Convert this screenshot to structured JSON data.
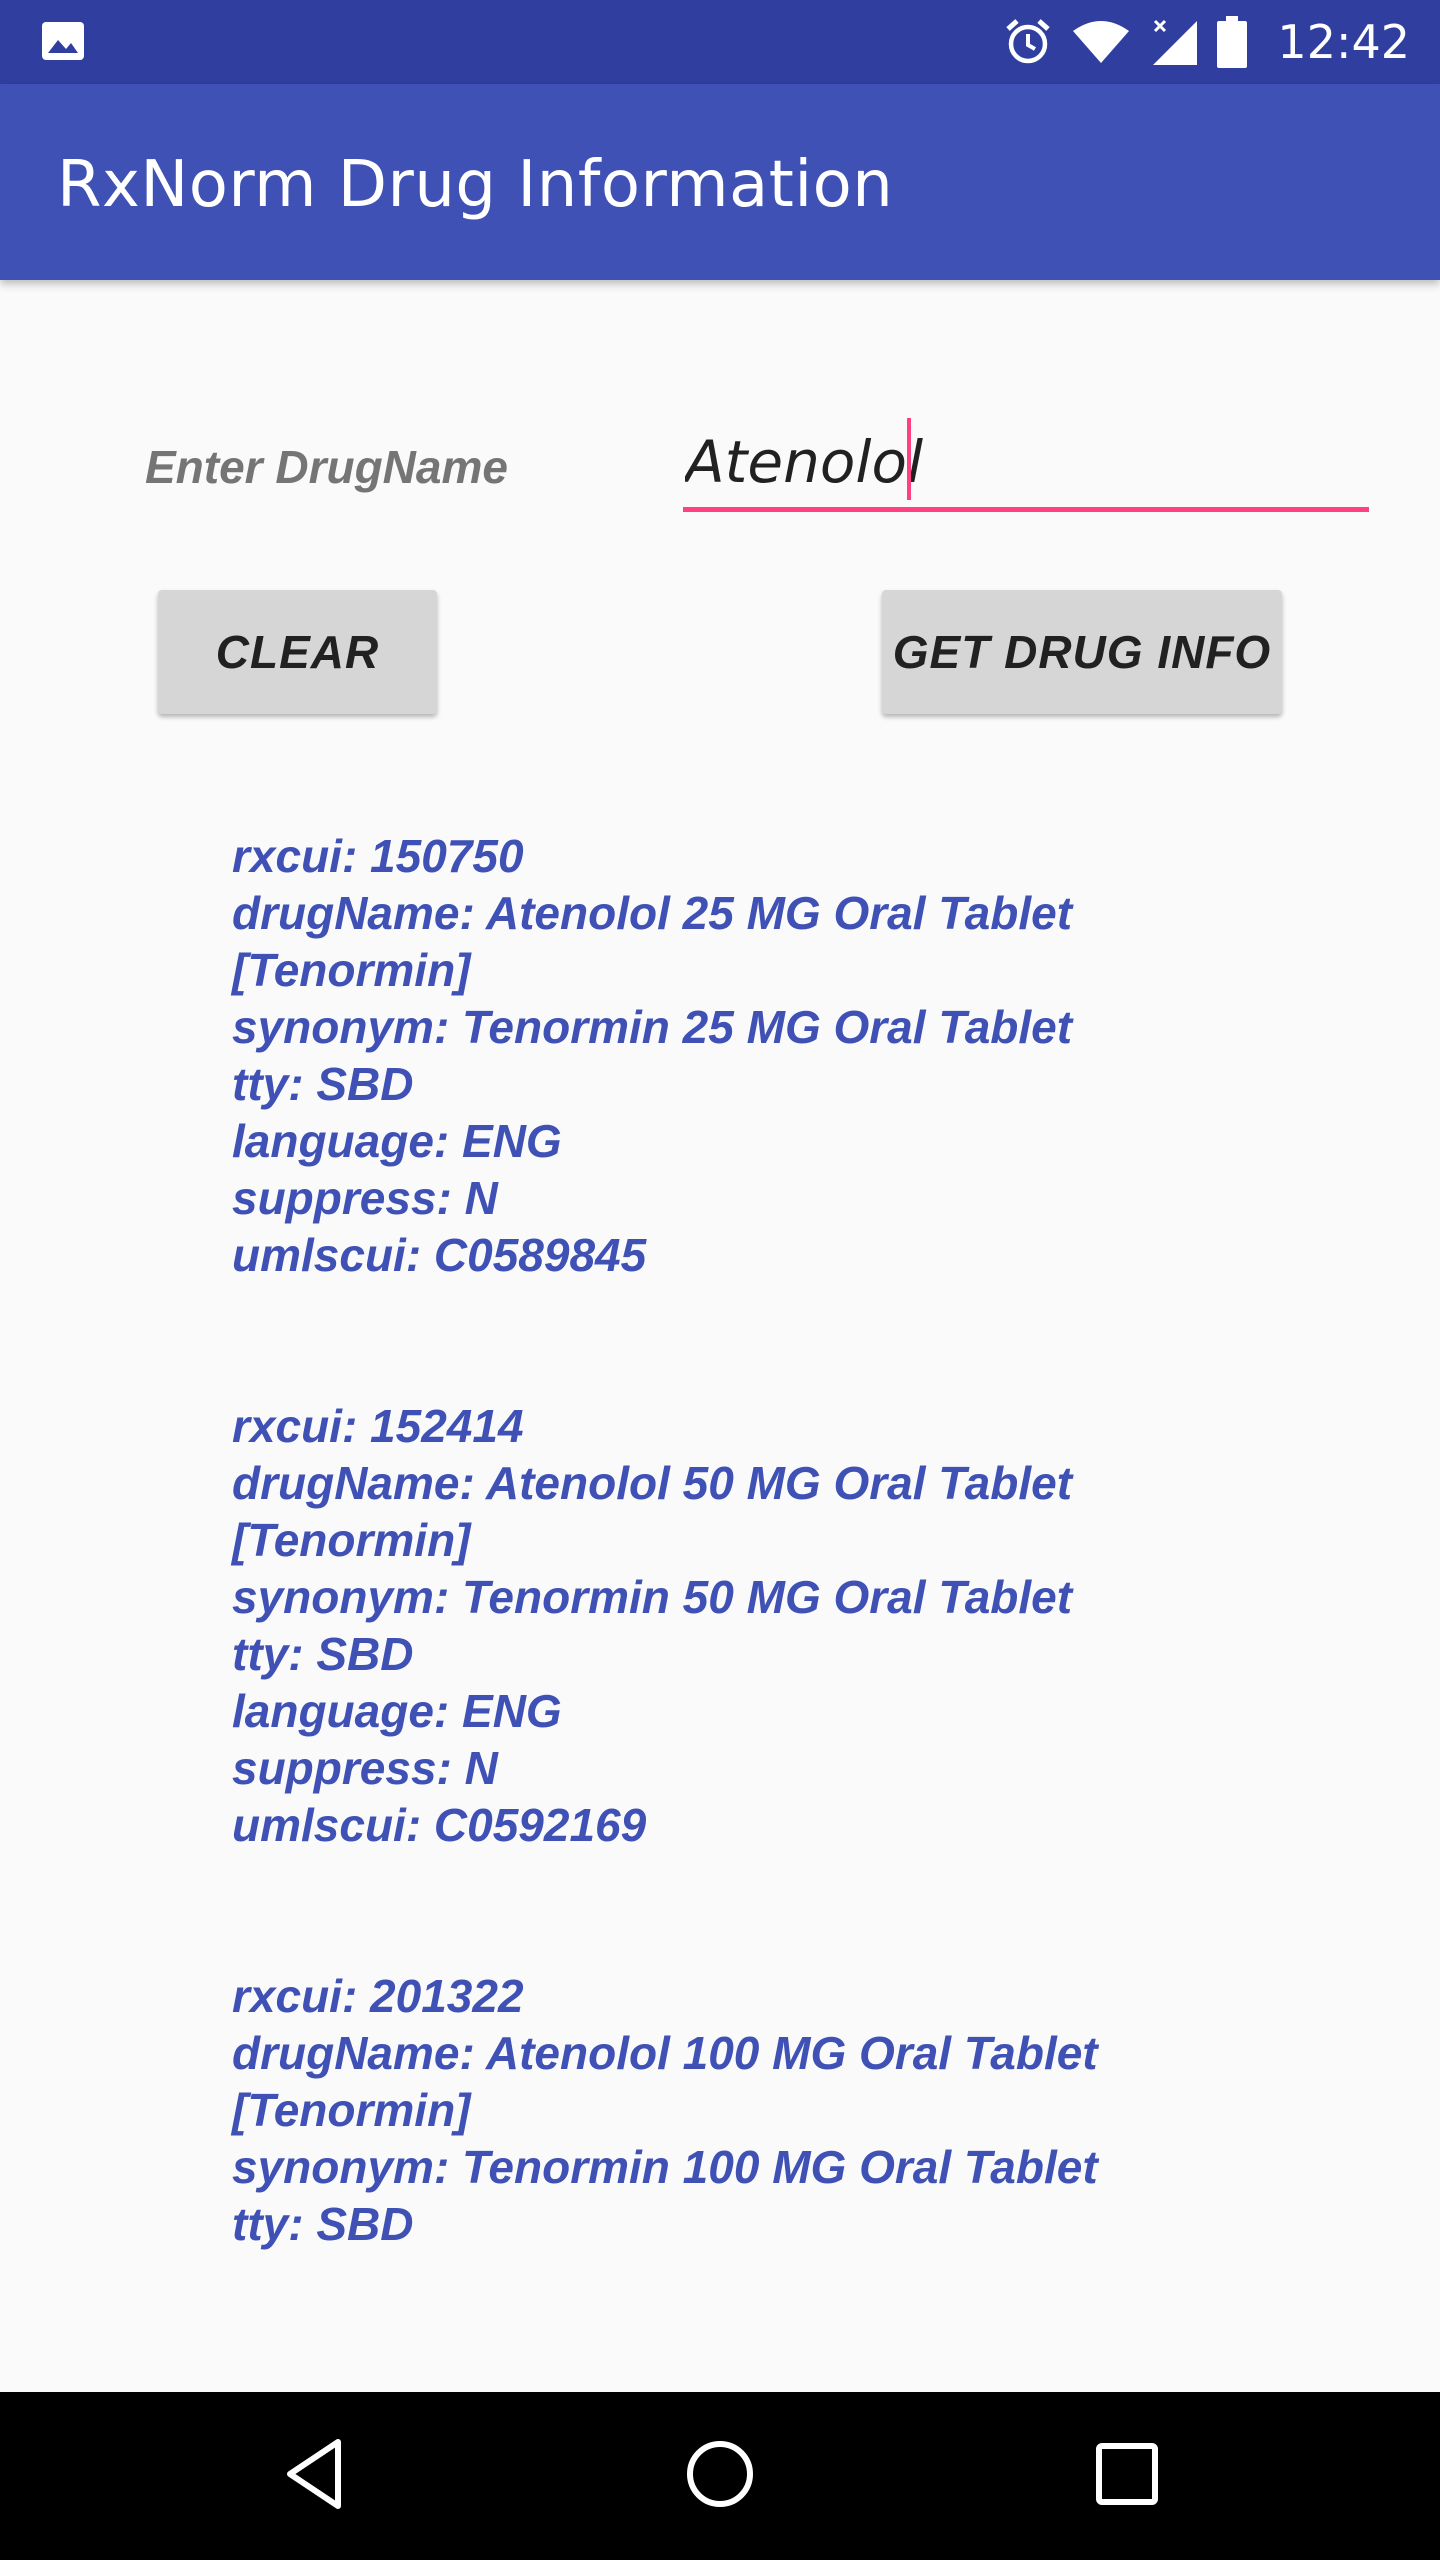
{
  "status_bar": {
    "time": "12:42",
    "icons": [
      "gallery-icon",
      "alarm-icon",
      "wifi-icon",
      "signal-icon",
      "battery-icon"
    ]
  },
  "app_bar": {
    "title": "RxNorm Drug Information"
  },
  "form": {
    "label": "Enter DrugName",
    "input_value": "Atenolol",
    "clear_label": "CLEAR",
    "get_info_label": "GET DRUG INFO"
  },
  "results": [
    {
      "rxcui": "rxcui: 150750",
      "drugName_line1": "drugName: Atenolol 25 MG Oral Tablet",
      "drugName_line2": "[Tenormin]",
      "synonym": "synonym: Tenormin 25 MG Oral Tablet",
      "tty": "tty: SBD",
      "language": "language: ENG",
      "suppress": "suppress: N",
      "umlscui": "umlscui: C0589845"
    },
    {
      "rxcui": "rxcui: 152414",
      "drugName_line1": "drugName: Atenolol 50 MG Oral Tablet",
      "drugName_line2": "[Tenormin]",
      "synonym": "synonym: Tenormin 50 MG Oral Tablet",
      "tty": "tty: SBD",
      "language": "language: ENG",
      "suppress": "suppress: N",
      "umlscui": "umlscui: C0592169"
    },
    {
      "rxcui": "rxcui: 201322",
      "drugName_line1": "drugName: Atenolol 100 MG Oral Tablet",
      "drugName_line2": "[Tenormin]",
      "synonym": "synonym: Tenormin 100 MG Oral Tablet",
      "tty": "tty: SBD"
    }
  ],
  "colors": {
    "status_bar": "#303f9f",
    "app_bar": "#3f51b5",
    "accent": "#ff4081",
    "result_text": "#3f51b5"
  },
  "nav_bar": {
    "icons": [
      "back-icon",
      "home-icon",
      "recents-icon"
    ]
  }
}
